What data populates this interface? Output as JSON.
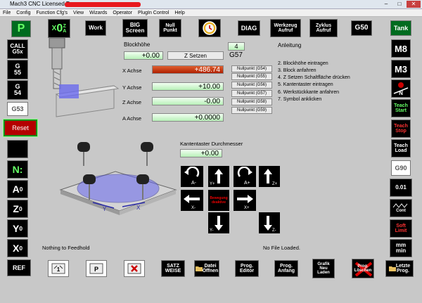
{
  "window": {
    "title": "Mach3 CNC  Licensed To:",
    "controls": [
      "–",
      "□",
      "✕"
    ]
  },
  "menu": [
    "File",
    "Config",
    "Function Cfg's",
    "View",
    "Wizards",
    "Operator",
    "PlugIn Control",
    "Help"
  ],
  "topbar": {
    "p": "P",
    "work": "Work",
    "big1": "BIG",
    "big2": "Screen",
    "null1": "Null",
    "null2": "Punkt",
    "diag": "DIAG",
    "wz1": "Werkzeug",
    "wz2": "Aufruf",
    "zy1": "Zyklus",
    "zy2": "Aufruf",
    "g50": "G50",
    "tank": "Tank"
  },
  "left": {
    "call1": "CALL",
    "call2": "G5x",
    "g55a": "G",
    "g55b": "55",
    "g54a": "G",
    "g54b": "54",
    "g53": "G53",
    "reset": "Reset",
    "n": "N:",
    "a": "A",
    "z": "Z",
    "y": "Y",
    "x": "X",
    "zero": "0",
    "ref": "REF"
  },
  "right": {
    "m8": "M8",
    "m3": "M3",
    "teach": "Teach",
    "start": "Start",
    "stop": "Stop",
    "load": "Load",
    "g90": "G90",
    "step": "0.01",
    "cont": "Cont",
    "soft": "Soft",
    "limit": "Limit",
    "mm1": "mm",
    "mm2": "min"
  },
  "panel": {
    "blockhoehe": "Blockhöhe",
    "block_value": "+0.00",
    "zsetzen": "Z Setzen",
    "tool_num": "4",
    "gcode": "G57",
    "axes": [
      {
        "label": "X Achse",
        "value": "+486.74",
        "btn": "Nullpunkt (G54)",
        "alarm": "true"
      },
      {
        "label": "Y Achse",
        "value": "+10.00",
        "btn": "Nullpunkt (G55)",
        "alarm": "false"
      },
      {
        "label": "Z Achse",
        "value": "-0.00",
        "btn": "Nullpunkt (G56)",
        "alarm": "false"
      },
      {
        "label": "A Achse",
        "value": "+0.0000",
        "btn": "Nullpunkt (G57)",
        "alarm": "false"
      }
    ],
    "extra_btns": [
      "Nullpunkt (G58)",
      "Nullpunkt (G59)"
    ],
    "anleitung": "Anleitung",
    "steps": [
      "2. Blockhöhe eintragen",
      "3. Block anfahren",
      "4. Z Setzen Schaltfläche drücken",
      "5. Kantentaster eintragen",
      "6. Werkstückkante anfahren",
      "7. Symbol anklicken"
    ],
    "kanten_label": "Kantentaster Durchmesser",
    "kanten_value": "+0.00",
    "bewegung1": "Bewegung",
    "bewegung2": "deaktive"
  },
  "status": {
    "left": "Nothing to Feedhold",
    "right": "No File Loaded."
  },
  "bottom": {
    "satz1": "SATZ",
    "satz2": "WEISE",
    "datei1": "Datei",
    "datei2": "Öffnen",
    "ed1": "Prog.",
    "ed2": "Editor",
    "an1": "Prog.",
    "an2": "Anfang",
    "gr1": "Grafik",
    "gr2": "Neu",
    "gr3": "Laden",
    "lo1": "Prog.",
    "lo2": "Löschen",
    "lz1": "Letzte",
    "lz2": "Prog."
  },
  "colors": {
    "accent_green": "#006b1f",
    "alarm_red": "#c03010",
    "field_green": "#b8f0b8"
  }
}
